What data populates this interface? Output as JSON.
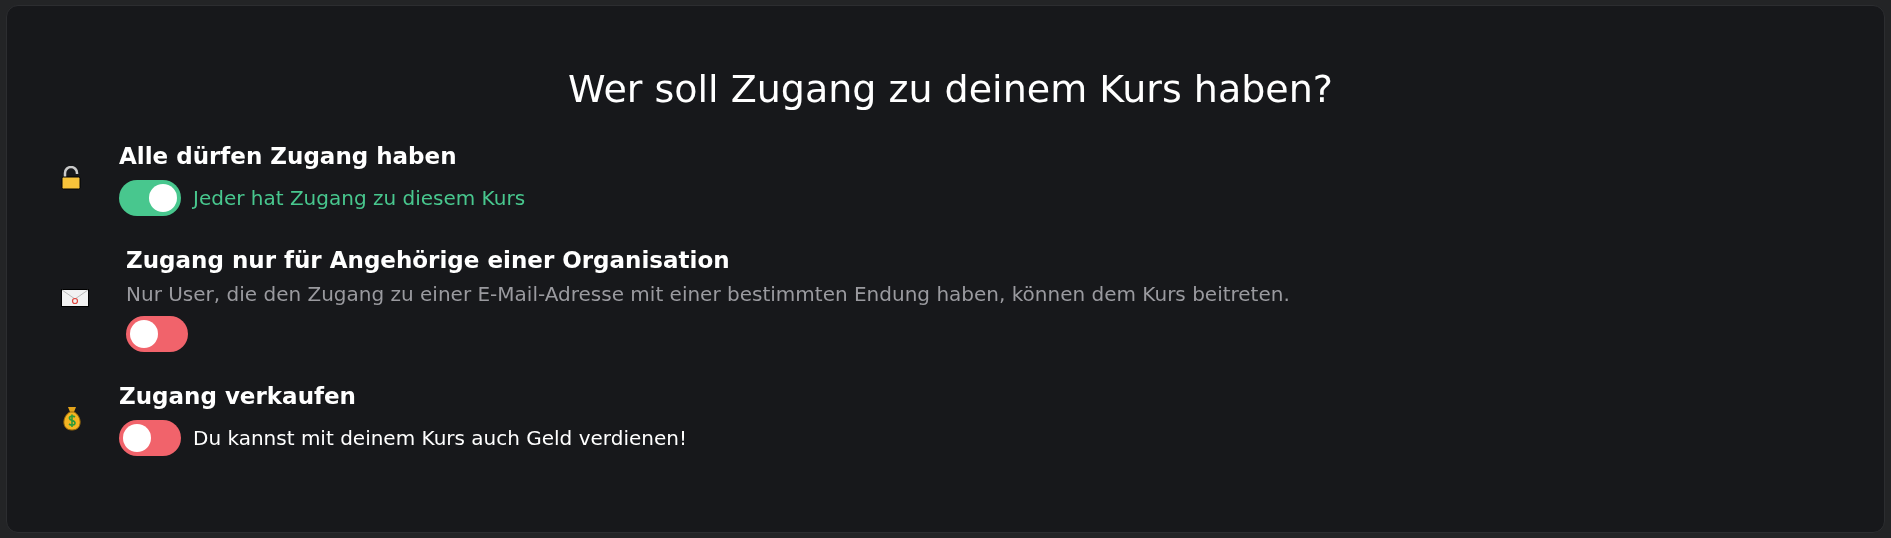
{
  "title": "Wer soll Zugang zu deinem Kurs haben?",
  "options": [
    {
      "kind": "inline",
      "heading": "Alle dürfen Zugang haben",
      "on": true,
      "description": "Jeder hat Zugang zu diesem Kurs"
    },
    {
      "kind": "stacked",
      "heading": "Zugang nur für Angehörige einer Organisation",
      "on": false,
      "description": "Nur User, die den Zugang zu einer E-Mail-Adresse mit einer bestimmten Endung haben, können dem Kurs beitreten."
    },
    {
      "kind": "inline",
      "heading": "Zugang verkaufen",
      "on": false,
      "description": "Du kannst mit deinem Kurs auch Geld verdienen!"
    }
  ]
}
